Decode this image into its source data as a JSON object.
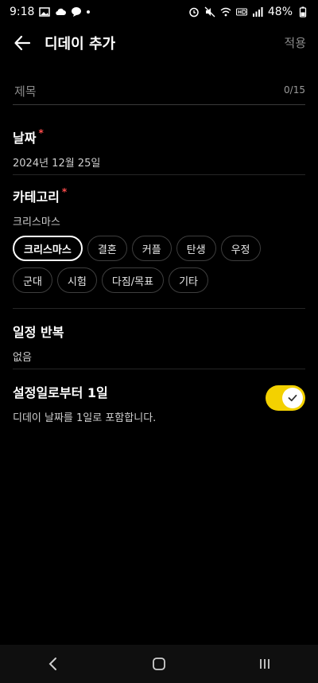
{
  "status": {
    "time": "9:18",
    "battery": "48%"
  },
  "appbar": {
    "title": "디데이 추가",
    "apply_label": "적용"
  },
  "title_field": {
    "placeholder": "제목",
    "counter": "0/15"
  },
  "date": {
    "label": "날짜",
    "required_mark": "*",
    "value": "2024년 12월 25일"
  },
  "category": {
    "label": "카테고리",
    "required_mark": "*",
    "value": "크리스마스",
    "chips_row1": [
      "크리스마스",
      "결혼",
      "커플",
      "탄생",
      "우정"
    ],
    "chips_row2": [
      "군대",
      "시험",
      "다짐/목표",
      "기타"
    ],
    "selected": "크리스마스"
  },
  "repeat": {
    "label": "일정 반복",
    "value": "없음"
  },
  "count_from_one": {
    "label": "설정일로부터 1일",
    "desc": "디데이 날짜를 1일로 포함합니다.",
    "enabled": true
  },
  "colors": {
    "accent": "#f3d100",
    "required": "#ff4d4d"
  }
}
